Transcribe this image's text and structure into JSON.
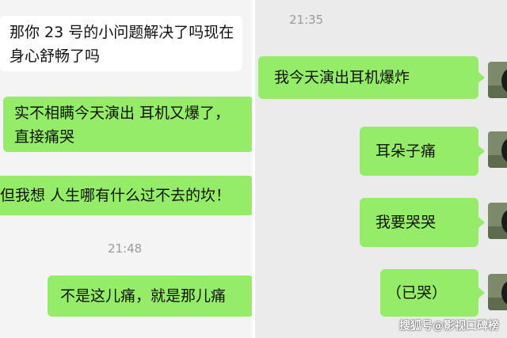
{
  "left_chat": {
    "messages": [
      {
        "text_line1": "那你 23 号的小问题解决了吗现在",
        "text_line2": "身心舒畅了吗"
      },
      {
        "text_line1": "实不相瞒今天演出 耳机又爆了，",
        "text_line2": "直接痛哭"
      },
      {
        "text": "但我想 人生哪有什么过不去的坎！"
      },
      {
        "text": "不是这儿痛，就是那儿痛"
      }
    ],
    "timestamp": "21:48"
  },
  "right_chat": {
    "timestamp": "21:35",
    "messages": [
      {
        "text": "我今天演出耳机爆炸"
      },
      {
        "text": "耳朵子痛"
      },
      {
        "text": "我要哭哭"
      },
      {
        "text": "（已哭）"
      }
    ],
    "avatar_icon": "dog-avatar-icon"
  },
  "watermark": "搜狐号@影视口碑榜",
  "colors": {
    "green_bubble": "#95ec69",
    "white_bubble": "#ffffff",
    "timestamp": "#9a9a9a"
  }
}
